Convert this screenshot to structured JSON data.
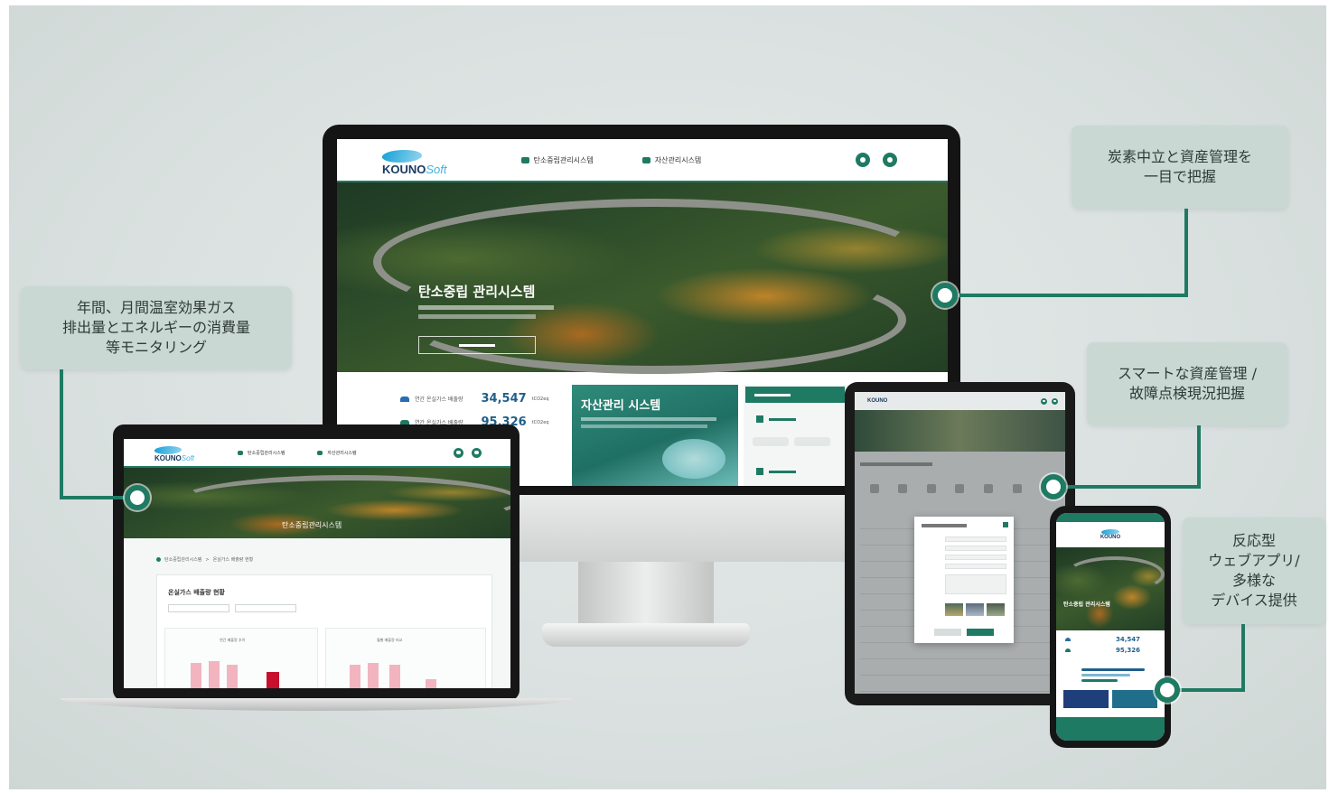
{
  "callouts": {
    "carbon_assets": [
      "炭素中立と資産管理を",
      "一目で把握"
    ],
    "monitoring": [
      "年間、月間温室効果ガス",
      "排出量とエネルギーの消費量",
      "等モニタリング"
    ],
    "smart_assets": [
      "スマートな資産管理 /",
      "故障点検現況把握"
    ],
    "responsive": [
      "反応型",
      "ウェブアプリ/",
      "多様な",
      "デバイス提供"
    ]
  },
  "site": {
    "logo": {
      "main": "KOUNO",
      "sub": "Soft"
    },
    "nav": [
      "탄소중립관리시스템",
      "자산관리시스템"
    ],
    "hero_title": "탄소중립 관리시스템",
    "asset_card_title": "자산관리 시스템",
    "stats": [
      {
        "label": "연간 온실가스 배출량",
        "value": "34,547",
        "unit": "tCO2eq"
      },
      {
        "label": "연간 온실가스 배출량",
        "value": "95,326",
        "unit": "tCO2eq"
      }
    ]
  },
  "laptop": {
    "hero_title": "탄소중립관리시스템",
    "breadcrumb": [
      "탄소중립관리시스템",
      "온실가스 배출량 현황"
    ],
    "section_title": "온실가스 배출량 현황",
    "chart_titles": [
      "연간 배출량 추이",
      "월별 배출량 비교"
    ]
  },
  "phone": {
    "stats": [
      "34,547",
      "95,326"
    ]
  },
  "colors": {
    "accent": "#1f7a63",
    "callout_bg": "#c9d8d2",
    "bar_pink": "#f2b4bf",
    "bar_red": "#c8102e"
  }
}
